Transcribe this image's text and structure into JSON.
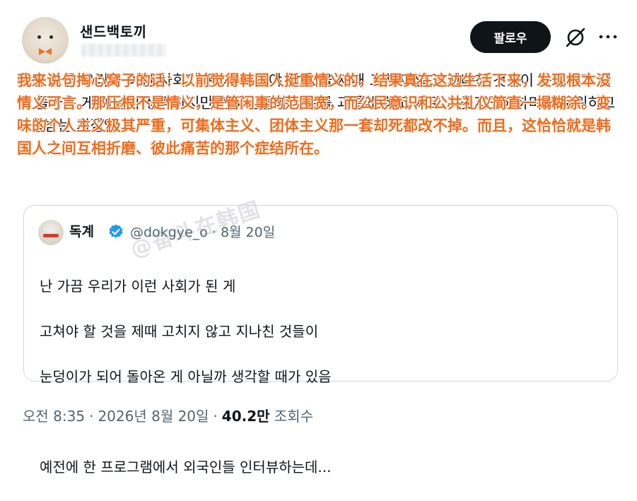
{
  "author": {
    "display_name": "샌드백토끼"
  },
  "follow_button": "팔로우",
  "icons": {
    "grok": "grok-slash-icon",
    "more": "more-dots-icon",
    "verified": "verified-badge-icon"
  },
  "tweet": {
    "text": "나는 가끔 우리가 이런 사회가 된 게 고쳐야 할 것을 제때 고치지 않고 지나친 것들이 눈덩이가 되어 돌아온 게 아닐까 생각하지만 한국인들이 서로를 괴롭게 하고 서로 지긋지긋해하며 괴로워하고 고통받는 지점임",
    "overlay_translation": "我来说句掏心窝子的话：以前觉得韩国人挺重情义的，结果真在这边生活下来，发现根本没情义可言。那压根不是情义，是管闲事的范围宽，而公民意识和公共礼仪简直一塌糊涂。变味的个人主义极其严重，可集体主义、团体主义那一套却死都改不掉。而且，这恰恰就是韩国人之间互相折磨、彼此痛苦的那个症结所在。",
    "watermark": "@奋斗在韩国"
  },
  "quote": {
    "name": "독계",
    "handle": "@dokgye_o",
    "date": "8월 20일",
    "lines": [
      "난 가끔 우리가 이런 사회가 된 게",
      "고쳐야 할 것을 제때 고치지 않고 지나친 것들이",
      "눈덩이가 되어 돌아온 게 아닐까 생각할 때가 있음",
      "",
      "예전에 한 프로그램에서 외국인들 인터뷰하는데..."
    ]
  },
  "footer": {
    "time": "오전 8:35",
    "date": "2026년 8월 20일",
    "views_count": "40.2만",
    "views_label": "조회수"
  },
  "colors": {
    "overlay": "#ee6c1d",
    "button_bg": "#0f1419",
    "verified": "#1d9bf0",
    "meta": "#536471"
  }
}
